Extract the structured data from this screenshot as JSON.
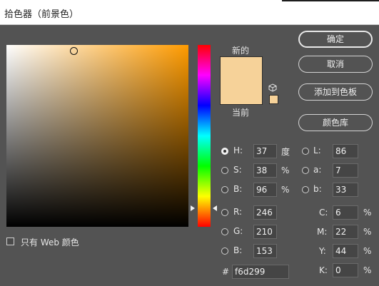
{
  "window": {
    "title": "拾色器（前景色）"
  },
  "swatch": {
    "new_label": "新的",
    "current_label": "当前"
  },
  "buttons": {
    "ok": "确定",
    "cancel": "取消",
    "add_to_swatches": "添加到色板",
    "color_libraries": "颜色库"
  },
  "hsb": {
    "h": {
      "label": "H:",
      "value": "37",
      "unit": "度",
      "selected": true
    },
    "s": {
      "label": "S:",
      "value": "38",
      "unit": "%"
    },
    "b": {
      "label": "B:",
      "value": "96",
      "unit": "%"
    }
  },
  "lab": {
    "l": {
      "label": "L:",
      "value": "86"
    },
    "a": {
      "label": "a:",
      "value": "7"
    },
    "b": {
      "label": "b:",
      "value": "33"
    }
  },
  "rgb": {
    "r": {
      "label": "R:",
      "value": "246"
    },
    "g": {
      "label": "G:",
      "value": "210"
    },
    "b": {
      "label": "B:",
      "value": "153"
    }
  },
  "cmyk": {
    "c": {
      "label": "C:",
      "value": "6",
      "unit": "%"
    },
    "m": {
      "label": "M:",
      "value": "22",
      "unit": "%"
    },
    "y": {
      "label": "Y:",
      "value": "44",
      "unit": "%"
    },
    "k": {
      "label": "K:",
      "value": "0",
      "unit": "%"
    }
  },
  "hex": {
    "label": "#",
    "value": "f6d299"
  },
  "web_only": {
    "label": "只有 Web 颜色",
    "checked": false
  },
  "colors": {
    "selected": "#f6d299",
    "pure_hue": "#ff9b00",
    "panel_bg": "#535353"
  }
}
